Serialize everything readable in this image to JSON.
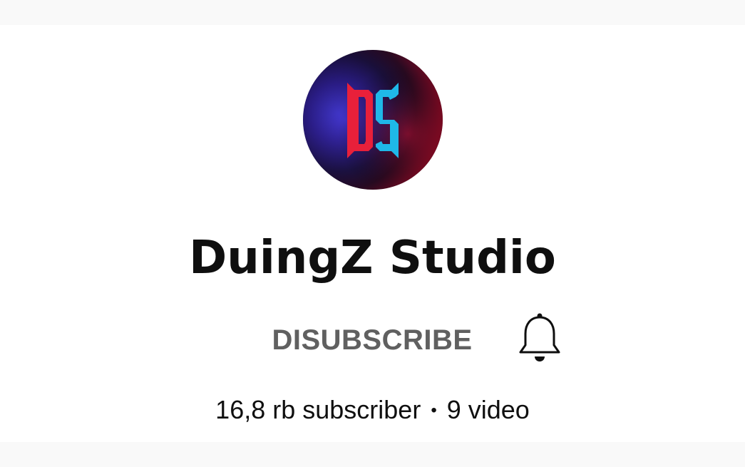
{
  "channel": {
    "name": "DuingZ Studio",
    "avatar_icon": "ds-logo-icon",
    "subscribers": "16,8 rb subscriber",
    "separator": "•",
    "videos": "9 video"
  },
  "actions": {
    "subscribe_label": "DISUBSCRIBE",
    "bell_icon": "bell-icon"
  },
  "colors": {
    "logo_red": "#e8203a",
    "logo_cyan": "#1fb8e8",
    "text_primary": "#0f0f0f",
    "text_secondary": "#606060"
  }
}
